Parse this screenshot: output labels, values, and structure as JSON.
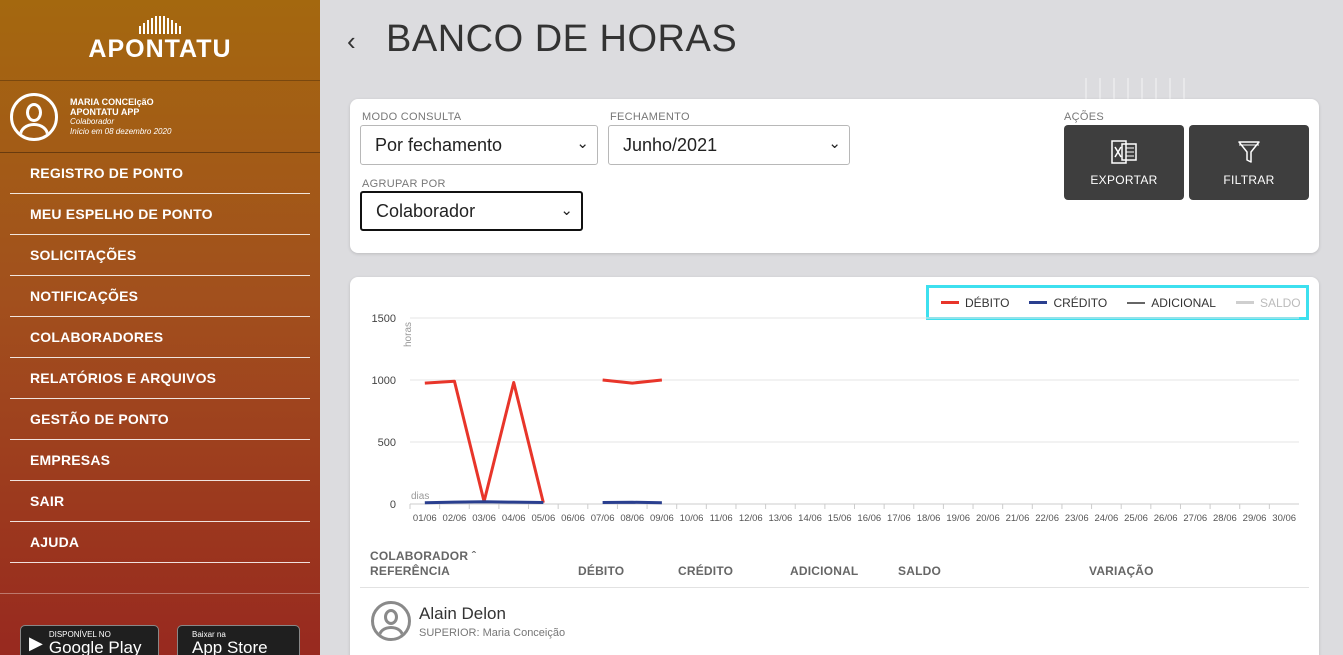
{
  "sidebar": {
    "brand": "APONTATU",
    "user": {
      "name": "MARIA CONCEIçãO",
      "company": "APONTATU APP",
      "role": "Colaborador",
      "since": "Início em 08 dezembro 2020"
    },
    "menu": [
      "REGISTRO DE PONTO",
      "MEU ESPELHO DE PONTO",
      "SOLICITAÇÕES",
      "NOTIFICAÇÕES",
      "COLABORADORES",
      "RELATÓRIOS E ARQUIVOS",
      "GESTÃO DE PONTO",
      "EMPRESAS",
      "SAIR",
      "AJUDA"
    ],
    "stores": {
      "google_small": "DISPONÍVEL NO",
      "google_big": "Google Play",
      "apple_small": "Baixar na",
      "apple_big": "App Store"
    }
  },
  "header": {
    "back_icon": "chevron-left-icon",
    "title": "BANCO DE HORAS"
  },
  "filters": {
    "modo_label": "MODO CONSULTA",
    "modo_value": "Por fechamento",
    "fechamento_label": "FECHAMENTO",
    "fechamento_value": "Junho/2021",
    "agrupar_label": "AGRUPAR POR",
    "agrupar_value": "Colaborador",
    "acoes_label": "AÇÕES",
    "exportar": "EXPORTAR",
    "filtrar": "FILTRAR"
  },
  "legend": {
    "debito": "DÉBITO",
    "credito": "CRÉDITO",
    "adicional": "ADICIONAL",
    "saldo": "SALDO"
  },
  "colors": {
    "debito": "#e8352a",
    "credito": "#2a3f8f",
    "adicional": "#666666",
    "saldo": "#cfcfcf",
    "highlight": "#3de0ef"
  },
  "chart_data": {
    "type": "line",
    "ylabel": "horas",
    "xlabel": "dias",
    "ylim": [
      0,
      1500
    ],
    "yticks": [
      0,
      500,
      1000,
      1500
    ],
    "grid": true,
    "legend_position": "top-right",
    "categories": [
      "01/06",
      "02/06",
      "03/06",
      "04/06",
      "05/06",
      "06/06",
      "07/06",
      "08/06",
      "09/06",
      "10/06",
      "11/06",
      "12/06",
      "13/06",
      "14/06",
      "15/06",
      "16/06",
      "17/06",
      "18/06",
      "19/06",
      "20/06",
      "21/06",
      "22/06",
      "23/06",
      "24/06",
      "25/06",
      "26/06",
      "27/06",
      "28/06",
      "29/06",
      "30/06"
    ],
    "series": [
      {
        "name": "DÉBITO",
        "values": [
          975,
          990,
          20,
          980,
          10,
          null,
          1000,
          975,
          1000,
          null,
          null,
          null,
          null,
          null,
          null,
          null,
          null,
          null,
          null,
          null,
          null,
          null,
          null,
          null,
          null,
          null,
          null,
          null,
          null,
          null
        ]
      },
      {
        "name": "CRÉDITO",
        "values": [
          10,
          15,
          18,
          15,
          12,
          null,
          12,
          14,
          10,
          null,
          null,
          null,
          null,
          null,
          null,
          null,
          null,
          null,
          null,
          null,
          null,
          null,
          null,
          null,
          null,
          null,
          null,
          null,
          null,
          null
        ]
      }
    ]
  },
  "table": {
    "col_colaborador": "COLABORADOR",
    "col_referencia": "REFERÊNCIA",
    "col_debito": "DÉBITO",
    "col_credito": "CRÉDITO",
    "col_adicional": "ADICIONAL",
    "col_saldo": "SALDO",
    "col_variacao": "VARIAÇÃO",
    "rows": [
      {
        "name": "Alain Delon",
        "superior": "SUPERIOR: Maria Conceição"
      }
    ]
  }
}
